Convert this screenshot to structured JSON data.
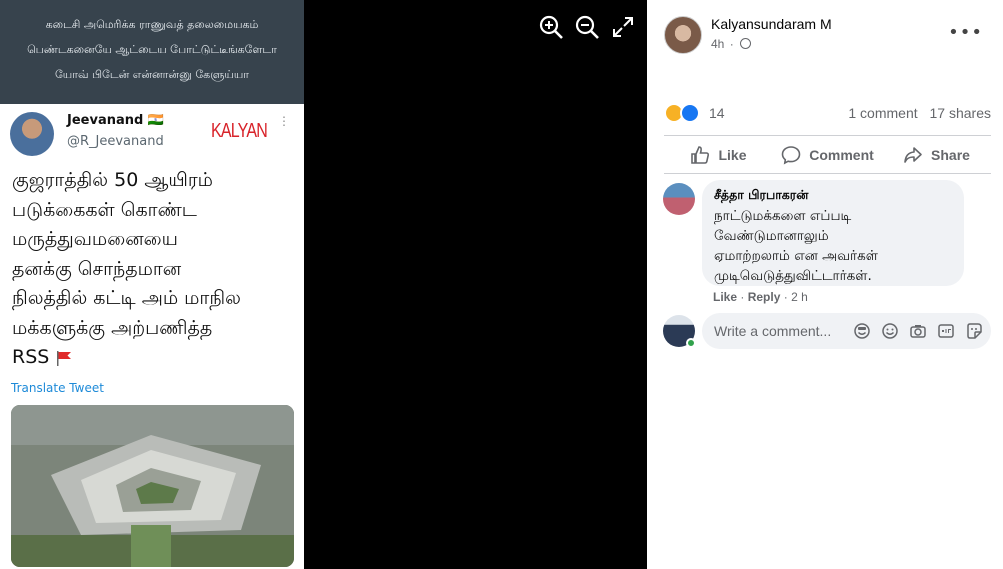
{
  "tweet_image": {
    "caption_lines": [
      "கடைசி அமெரிக்க ராணுவத் தலைமையகம்",
      "பெண்டகனையே ஆட்டைய போட்டுட்டீங்களேடா",
      "யோவ் பிடேன் என்னான்னு கேளுய்யா"
    ],
    "author_name": "Jeevanand 🇮🇳",
    "author_handle": "@R_Jeevanand",
    "watermark": "KALYAN",
    "body_lines": [
      "குஜராத்தில் 50 ஆயிரம்",
      "படுக்கைகள் கொண்ட",
      "மருத்துவமனையை",
      "தனக்கு சொந்தமான",
      "நிலத்தில் கட்டி அம் மாநில",
      "மக்களுக்கு அற்பணித்த",
      "RSS"
    ],
    "translate_label": "Translate Tweet"
  },
  "viewer_tools": {
    "icons": [
      "zoom-in-icon",
      "zoom-out-icon",
      "fullscreen-icon"
    ]
  },
  "post": {
    "author": "Kalyansundaram M",
    "time": "4h",
    "more": "•••",
    "reaction_count": "14",
    "comments": "1 comment",
    "shares": "17 shares",
    "actions": {
      "like": "Like",
      "comment": "Comment",
      "share": "Share"
    }
  },
  "comment": {
    "author": "சீத்தா பிரபாகரன்",
    "lines": [
      "நாட்டுமக்களை எப்படி",
      "வேண்டுமானாலும்",
      "ஏமாற்றலாம் என அவர்கள்",
      "முடிவெடுத்துவிட்டார்கள்."
    ],
    "like": "Like",
    "sep": "·",
    "reply": "Reply",
    "time": "2 h"
  },
  "composer": {
    "placeholder": "Write a comment..."
  },
  "colors": {
    "accent": "#1877f2",
    "caption_bg": "#37434d",
    "online": "#31a24c"
  }
}
